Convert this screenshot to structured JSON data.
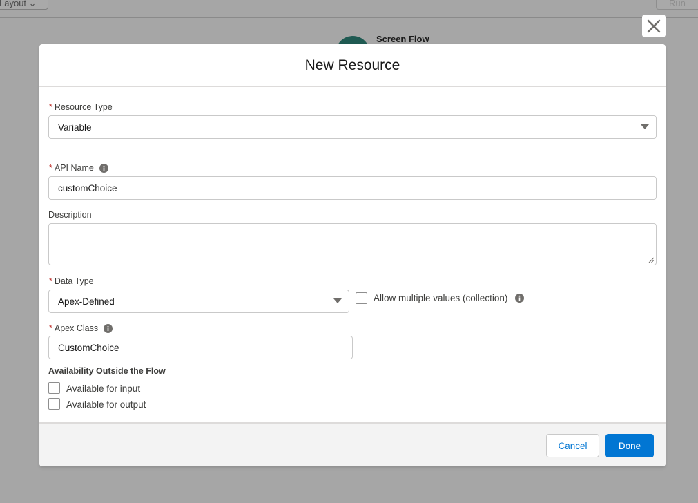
{
  "background": {
    "layout_button_label": "Layout",
    "run_button_label": "Run",
    "flow_type": "Screen Flow"
  },
  "modal": {
    "title": "New Resource",
    "close_icon": "close-icon",
    "resource_type": {
      "label": "Resource Type",
      "value": "Variable"
    },
    "api_name": {
      "label": "API Name",
      "value": "customChoice"
    },
    "description": {
      "label": "Description",
      "value": ""
    },
    "data_type": {
      "label": "Data Type",
      "value": "Apex-Defined"
    },
    "allow_multiple": {
      "label": "Allow multiple values (collection)",
      "checked": false
    },
    "apex_class": {
      "label": "Apex Class",
      "value": "CustomChoice"
    },
    "availability": {
      "title": "Availability Outside the Flow",
      "input_label": "Available for input",
      "output_label": "Available for output"
    },
    "footer": {
      "cancel_label": "Cancel",
      "done_label": "Done"
    }
  },
  "colors": {
    "brand": "#0176d3",
    "required": "#c23934",
    "overlay": "#a6a6a6"
  }
}
